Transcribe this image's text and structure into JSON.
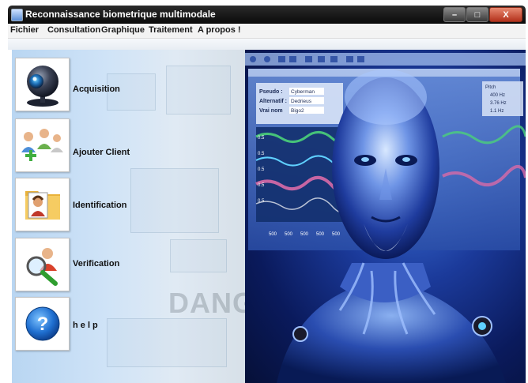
{
  "window": {
    "title": "Reconnaissance biometrique multimodale",
    "buttons": {
      "minimize": "–",
      "maximize": "□",
      "close": "X"
    }
  },
  "menu": {
    "items": [
      "Fichier",
      "Consultation",
      "Graphique",
      "Traitement",
      "A propos !"
    ]
  },
  "sidebar": {
    "items": [
      {
        "label": "Acquisition",
        "icon": "webcam-icon"
      },
      {
        "label": "Ajouter Client",
        "icon": "add-users-icon"
      },
      {
        "label": "Identification",
        "icon": "id-folder-icon"
      },
      {
        "label": "Verification",
        "icon": "magnifier-user-icon"
      },
      {
        "label": "h e l p",
        "icon": "help-icon"
      }
    ]
  },
  "background": {
    "watermark_text": "DANGE"
  },
  "hero": {
    "panel": {
      "rows": [
        {
          "label": "Pseudo :",
          "value": "Cyberman"
        },
        {
          "label": "Alternatif :",
          "value": "Dedrieus"
        },
        {
          "label": "Vrai nom",
          "value": "Bigo2"
        }
      ],
      "right_values": [
        "Pitch",
        "400 Hz",
        "3.76 Hz",
        "1.1 Hz"
      ],
      "left_numbers": [
        "0.5",
        "0.5",
        "0.5",
        "0.5",
        "0.5"
      ],
      "bottom_numbers": [
        "500",
        "500",
        "500",
        "500",
        "500"
      ]
    }
  },
  "colors": {
    "titlebar": "#111111",
    "sidebar_left": "#b9d6f2",
    "hero_blue": "#1b3a9a",
    "accent_cyan": "#5fd0ff"
  }
}
